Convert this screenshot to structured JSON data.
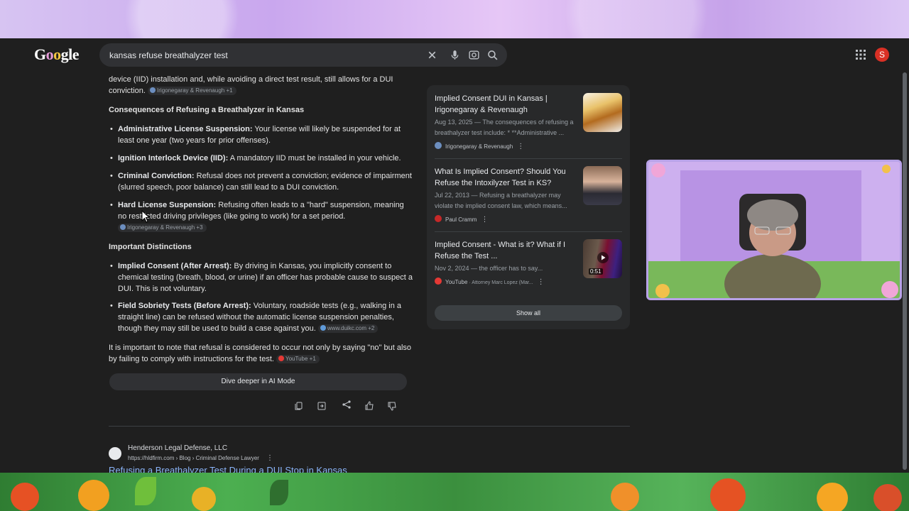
{
  "search": {
    "query": "kansas refuse breathalyzer test"
  },
  "account": {
    "initial": "S"
  },
  "ai_overview": {
    "intro_tail_1": "device (IID) installation and, while avoiding a direct test result, still allows for a DUI",
    "intro_tail_2": "conviction.",
    "intro_cite": "Irigonegaray & Revenaugh +1",
    "consequences_heading": "Consequences of Refusing a Breathalyzer in Kansas",
    "consequences": [
      {
        "term": "Administrative License Suspension:",
        "text": " Your license will likely be suspended for at least one year (two years for prior offenses)."
      },
      {
        "term": "Ignition Interlock Device (IID):",
        "text": " A mandatory IID must be installed in your vehicle."
      },
      {
        "term": "Criminal Conviction:",
        "text": " Refusal does not prevent a conviction; evidence of impairment (slurred speech, poor balance) can still lead to a DUI conviction."
      },
      {
        "term": "Hard License Suspension:",
        "text": " Refusing often leads to a \"hard\" suspension, meaning no restricted driving privileges (like going to work) for a set period.",
        "cite": "Irigonegaray & Revenaugh +3"
      }
    ],
    "distinctions_heading": "Important Distinctions",
    "distinctions": [
      {
        "term": "Implied Consent (After Arrest):",
        "text": " By driving in Kansas, you implicitly consent to chemical testing (breath, blood, or urine) if an officer has probable cause to suspect a DUI. This is not voluntary."
      },
      {
        "term": "Field Sobriety Tests (Before Arrest):",
        "text": " Voluntary, roadside tests (e.g., walking in a straight line) can be refused without the automatic license suspension penalties, though they may still be used to build a case against you.",
        "cite": "www.duikc.com +2"
      }
    ],
    "closing": "It is important to note that refusal is considered to occur not only by saying \"no\" but also by failing to comply with instructions for the test.",
    "closing_cite": "YouTube +1",
    "dive_deeper": "Dive deeper in AI Mode"
  },
  "sources": [
    {
      "title": "Implied Consent DUI in Kansas | Irigonegaray & Revenaugh",
      "snippet": "Aug 13, 2025 — The consequences of refusing a breathalyzer test include: * **Administrative ...",
      "site": "Irigonegaray & Revenaugh"
    },
    {
      "title": "What Is Implied Consent? Should You Refuse the Intoxilyzer Test in KS?",
      "snippet": "Jul 22, 2013 — Refusing a breathalyzer may violate the implied consent law, which means...",
      "site": "Paul Cramm"
    },
    {
      "title": "Implied Consent - What is it? What if I Refuse the Test ...",
      "snippet": "Nov 2, 2024 — the officer has to say...",
      "site": "YouTube",
      "site_sub": " · Attorney Marc Lopez (Mar...",
      "duration": "0:51"
    }
  ],
  "show_all": "Show all",
  "organic": {
    "site_name": "Henderson Legal Defense, LLC",
    "url": "https://hldfirm.com › Blog › Criminal Defense Lawyer",
    "title": "Refusing a Breathalyzer Test During a DUI Stop in Kansas"
  },
  "colors": {
    "link": "#8ab4f8",
    "bg": "#1f1f1f",
    "panel": "#28292a"
  }
}
